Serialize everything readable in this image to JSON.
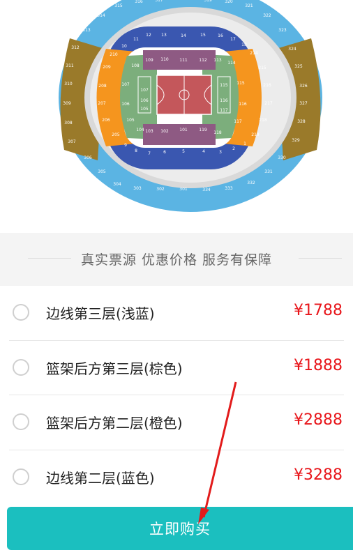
{
  "slogan": "真实票源  优惠价格  服务有保障",
  "options": [
    {
      "label": "边线第三层(浅蓝)",
      "price": "¥1788"
    },
    {
      "label": "篮架后方第三层(棕色)",
      "price": "¥1888"
    },
    {
      "label": "篮架后方第二层(橙色)",
      "price": "¥2888"
    },
    {
      "label": "边线第二层(蓝色)",
      "price": "¥3288"
    }
  ],
  "buy_label": "立即购买",
  "colors": {
    "tier3_side": "#5bb4e3",
    "tier3_end": "#9a7a2a",
    "tier2_end": "#f5951e",
    "tier2_side": "#3a57b0",
    "tier1_side": "#8e5a83",
    "tier1_end": "#7cae7c",
    "court": "#c4575b",
    "price": "#e8161b",
    "button": "#1bbfbf"
  },
  "map_sections": {
    "upper_top": [
      "315",
      "316",
      "317",
      "319",
      "320",
      "321",
      "322",
      "323"
    ],
    "upper_left": [
      "314",
      "313",
      "312",
      "311",
      "310",
      "309",
      "308",
      "307",
      "306",
      "305",
      "304"
    ],
    "upper_right": [
      "324",
      "325",
      "326",
      "327",
      "328",
      "329",
      "330",
      "331",
      "332"
    ],
    "upper_bottom": [
      "303",
      "302",
      "301",
      "334",
      "333"
    ],
    "mid_top": [
      "11",
      "12",
      "13",
      "14",
      "15",
      "16",
      "17"
    ],
    "mid_left_orange": [
      "210",
      "209",
      "208",
      "207",
      "206",
      "205"
    ],
    "mid_right_orange": [
      "214",
      "215",
      "216",
      "217",
      "218",
      "219"
    ],
    "mid_bottom": [
      "9",
      "8",
      "7",
      "6",
      "5",
      "4",
      "3",
      "2",
      "1"
    ],
    "lower_top": [
      "109",
      "110",
      "111",
      "112",
      "113"
    ],
    "lower_bottom": [
      "103",
      "102",
      "101",
      "119",
      "118"
    ],
    "lower_left": [
      "108",
      "107",
      "106",
      "105",
      "104",
      "107",
      "106",
      "105"
    ],
    "lower_right": [
      "114",
      "115",
      "116",
      "117",
      "115",
      "116",
      "117"
    ],
    "mid_corner": [
      "10",
      "18"
    ]
  }
}
